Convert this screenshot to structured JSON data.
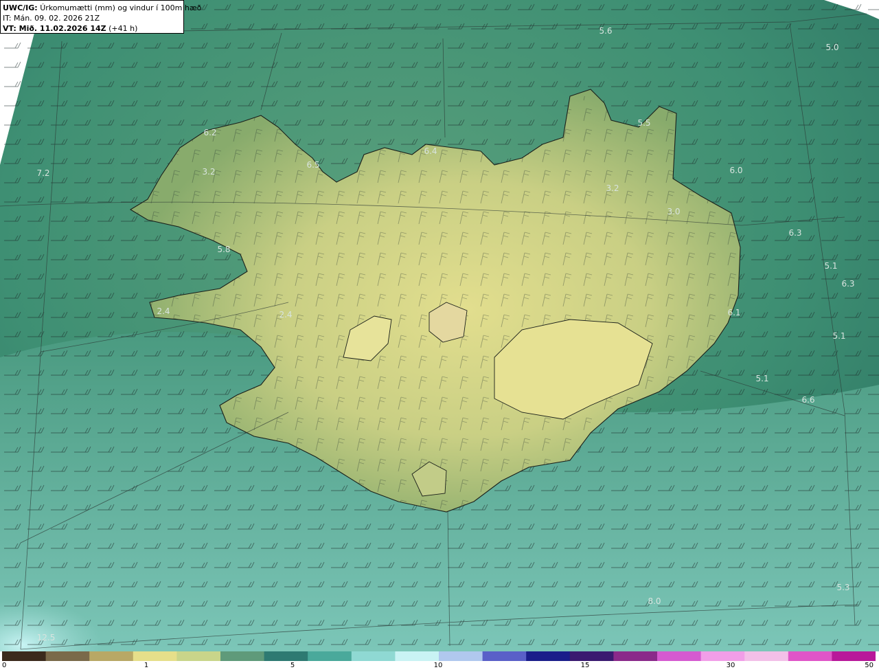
{
  "header": {
    "model": "UWC/IG:",
    "title": "Úrkomumætti (mm) og vindur í 100m hæð",
    "it": "IT: Mán. 09. 02. 2026 21Z",
    "vt_bold": "VT: Mið. 11.02.2026 14Z",
    "vt_extra": "(+41 h)"
  },
  "colorbar": {
    "ticks": [
      "0",
      "1",
      "5",
      "10",
      "15",
      "30",
      "50"
    ],
    "colors": [
      "#3b2a1c",
      "#7a6a4a",
      "#b8a865",
      "#e6df8a",
      "#c9d58a",
      "#5f9a7a",
      "#2e7a72",
      "#4aa99b",
      "#8fd9d3",
      "#c9f3f4",
      "#b0c8ee",
      "#5a60c8",
      "#1a1d8a",
      "#3a1a70",
      "#8a2a8a",
      "#d55ad0",
      "#f19ee8",
      "#f3bfe8",
      "#e055c8",
      "#b8189a"
    ]
  },
  "map": {
    "colors": {
      "sea": "#3e8f73",
      "sea_dark": "#2f7a65",
      "land": "#9fb96f",
      "highland": "#d6d88a",
      "south_sea": "#6cb6a6",
      "light": "#a9e2dc",
      "ice": "#b9ecec"
    },
    "value_labels": [
      {
        "text": "5.6"
      },
      {
        "text": "5.0"
      },
      {
        "text": "6.2"
      },
      {
        "text": "6.4"
      },
      {
        "text": "5.5"
      },
      {
        "text": "7.2"
      },
      {
        "text": "3.2"
      },
      {
        "text": "6.5"
      },
      {
        "text": "6.0"
      },
      {
        "text": "3.2"
      },
      {
        "text": "3.0"
      },
      {
        "text": "6.3"
      },
      {
        "text": "5.8"
      },
      {
        "text": "5.1"
      },
      {
        "text": "6.3"
      },
      {
        "text": "2.4"
      },
      {
        "text": "2.4"
      },
      {
        "text": "6.1"
      },
      {
        "text": "5.1"
      },
      {
        "text": "5.1"
      },
      {
        "text": "6.6"
      },
      {
        "text": "5.3"
      },
      {
        "text": "8.0"
      },
      {
        "text": "12.5"
      }
    ]
  }
}
